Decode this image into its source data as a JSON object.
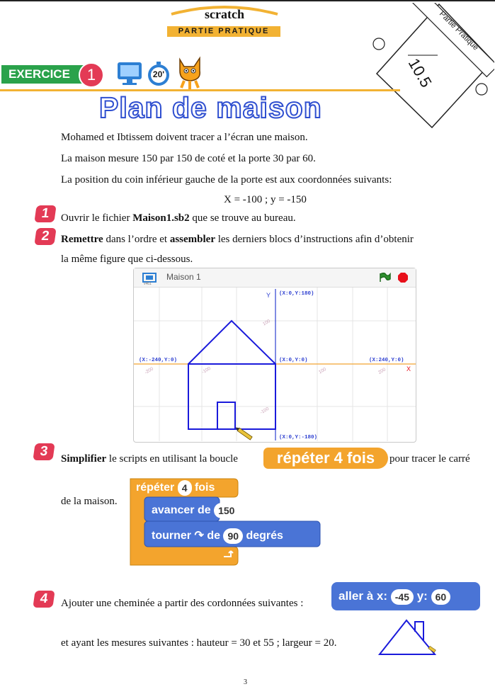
{
  "header": {
    "title": "scratch",
    "subtitle": "Partie pratique",
    "corner_label": "Partie Pratique",
    "corner_number": "10.5"
  },
  "exercise": {
    "label": "EXERCICE",
    "number": "1",
    "timer": "20'",
    "main_title": "Plan de maison"
  },
  "intro": {
    "line1": "Mohamed et Ibtissem doivent tracer a l’écran une maison.",
    "line2": "La maison mesure 150 par 150 de coté et la porte 30 par 60.",
    "line3": "La position du coin inférieur gauche de la porte est aux coordonnées suivants:",
    "coords": "X = -100 ; y =  -150"
  },
  "steps": {
    "s1": {
      "num": "1",
      "prefix": "Ouvrir le fichier ",
      "bold": "Maison1.sb2",
      "suffix": " que se trouve au bureau."
    },
    "s2": {
      "num": "2",
      "b1": "Remettre",
      "t1": " dans l’ordre et ",
      "b2": "assembler",
      "t2": " les derniers blocs d’instructions afin d’obtenir",
      "line2": "la même figure que ci-dessous."
    },
    "s3": {
      "num": "3",
      "bold": "Simplifier",
      "t1": " le scripts en utilisant la boucle ",
      "t2": " pour tracer le carré",
      "line2": "de la maison."
    },
    "s4": {
      "num": "4",
      "t1": "Ajouter une cheminée a partir des cordonnées suivantes :",
      "line2": "et ayant les mesures suivantes : hauteur = 30 et 55 ; largeur = 20."
    }
  },
  "stage": {
    "title": "Maison 1",
    "version": "v461",
    "y_axis_label": "Y",
    "x_axis_label": "X",
    "labels": {
      "top": "(X:0,Y:180)",
      "left": "(X:-240,Y:0)",
      "center": "(X:0,Y:0)",
      "right": "(X:240,Y:0)",
      "bottom": "(X:0,Y:-180)"
    },
    "ticks": {
      "y100": "100",
      "xm200": "-200",
      "xm100": "-100",
      "x100": "100",
      "x200": "200",
      "ym100": "-100"
    }
  },
  "blocks": {
    "repeat_button": "répéter 4 fois",
    "repeat": {
      "word1": "répéter",
      "count": "4",
      "word2": "fois"
    },
    "move": {
      "word": "avancer de",
      "value": "150"
    },
    "turn": {
      "word1": "tourner",
      "word2": "de",
      "value": "90",
      "word3": "degrés"
    },
    "goto": {
      "word": "aller à x:",
      "x": "-45",
      "ylabel": "y:",
      "y": "60"
    }
  },
  "footer": {
    "page": "3"
  },
  "colors": {
    "accent": "#f2b233",
    "green": "#2aa24b",
    "badge": "#e33a55",
    "house": "#1a1adb",
    "title_blue": "#2f4fd0"
  }
}
